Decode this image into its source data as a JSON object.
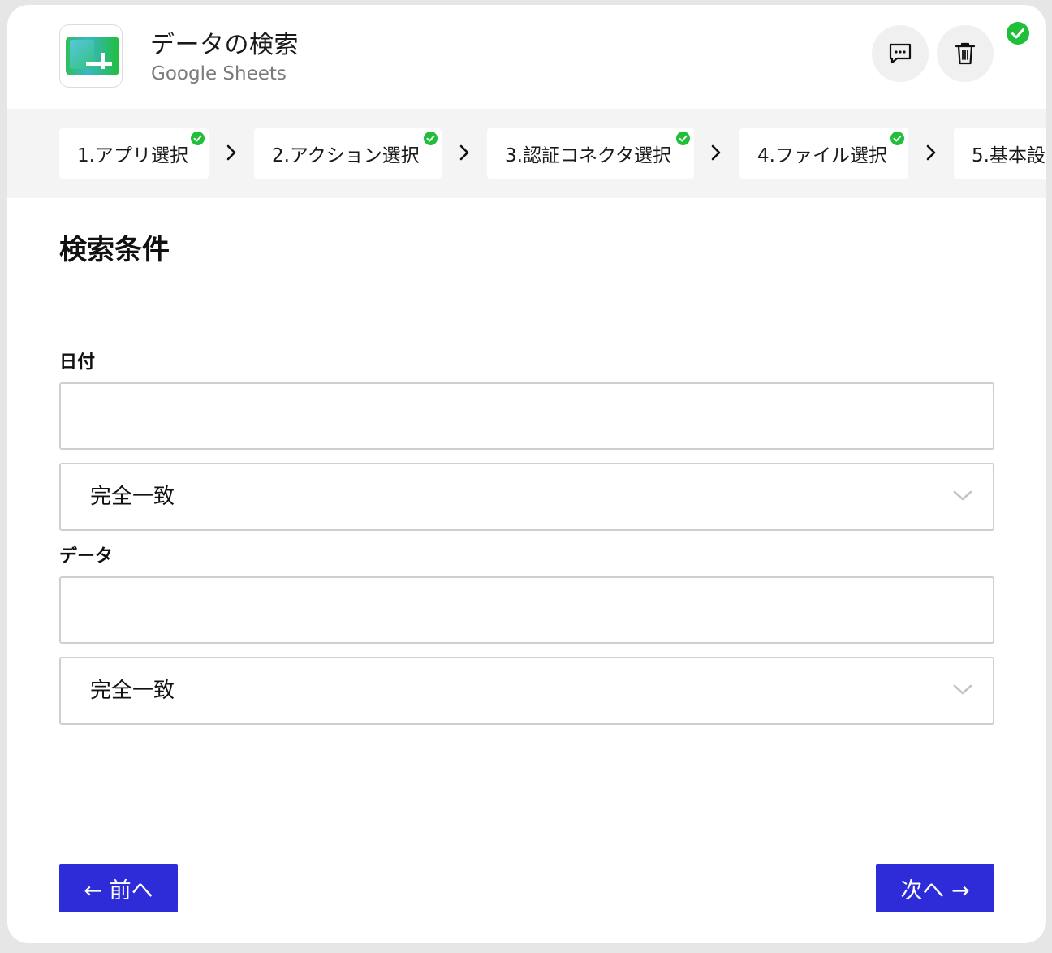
{
  "header": {
    "title": "データの検索",
    "subtitle": "Google Sheets",
    "app_icon": "google-sheets-icon",
    "comment_icon": "comment-icon",
    "delete_icon": "trash-icon",
    "status_icon": "check-circle-icon",
    "status_color": "#1fbf3a"
  },
  "steps": [
    {
      "label": "1.アプリ選択",
      "completed": true
    },
    {
      "label": "2.アクション選択",
      "completed": true
    },
    {
      "label": "3.認証コネクタ選択",
      "completed": true
    },
    {
      "label": "4.ファイル選択",
      "completed": true
    },
    {
      "label": "5.基本設",
      "completed": false
    }
  ],
  "section": {
    "title": "検索条件"
  },
  "fields": [
    {
      "label": "日付",
      "value": "",
      "match_option": "完全一致"
    },
    {
      "label": "データ",
      "value": "",
      "match_option": "完全一致"
    }
  ],
  "navigation": {
    "prev_label": "← 前へ",
    "next_label": "次へ →",
    "button_color": "#2e2bd9"
  }
}
